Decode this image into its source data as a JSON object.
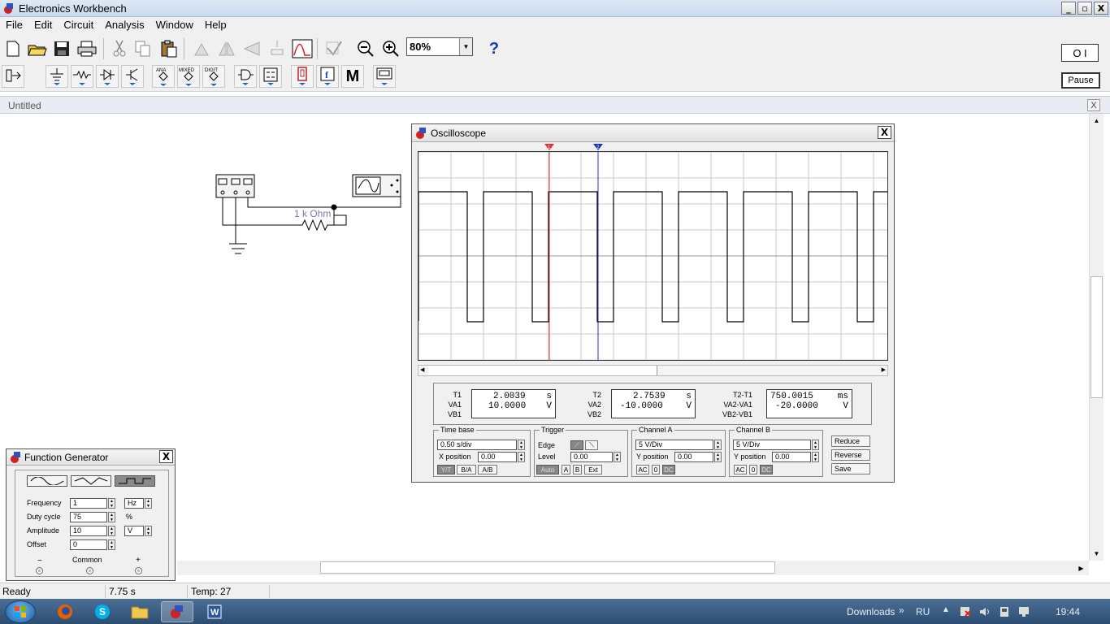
{
  "app": {
    "title": "Electronics Workbench",
    "min_glyph": "_",
    "restore_glyph": "▫",
    "close_glyph": "X"
  },
  "menu": [
    "File",
    "Edit",
    "Circuit",
    "Analysis",
    "Window",
    "Help"
  ],
  "toolbar": {
    "zoom_value": "80%",
    "help_label": "?",
    "power_label": "O I",
    "pause_label": "Pause",
    "parts_labels": {
      "analog": "ANA",
      "mixed": "MIXED",
      "digital": "DIGIT",
      "misc": "M"
    }
  },
  "document": {
    "title": "Untitled",
    "close_glyph": "X"
  },
  "circuit": {
    "resistor_label": "1 k Ohm"
  },
  "oscilloscope": {
    "title": "Oscilloscope",
    "close_glyph": "X",
    "cursor1_label": "1",
    "cursor2_label": "2",
    "readouts": {
      "t1_label": "T1",
      "va1_label": "VA1",
      "vb1_label": "VB1",
      "t1_value": "2.0039",
      "t1_unit": "s",
      "va1_value": "10.0000",
      "va1_unit": "V",
      "t2_label": "T2",
      "va2_label": "VA2",
      "vb2_label": "VB2",
      "t2_value": "2.7539",
      "t2_unit": "s",
      "va2_value": "-10.0000",
      "va2_unit": "V",
      "dt_label": "T2-T1",
      "dva_label": "VA2-VA1",
      "dvb_label": "VB2-VB1",
      "dt_value": "750.0015",
      "dt_unit": "ms",
      "dva_value": "-20.0000",
      "dva_unit": "V"
    },
    "timebase": {
      "group_label": "Time base",
      "value": "0.50 s/div",
      "xpos_label": "X position",
      "xpos_value": "0.00",
      "modes": [
        "Y/T",
        "B/A",
        "A/B"
      ]
    },
    "trigger": {
      "group_label": "Trigger",
      "edge_label": "Edge",
      "level_label": "Level",
      "level_value": "0.00",
      "sources": [
        "Auto",
        "A",
        "B",
        "Ext"
      ]
    },
    "channel_a": {
      "group_label": "Channel A",
      "value": "5 V/Div",
      "ypos_label": "Y position",
      "ypos_value": "0.00",
      "coupling": [
        "AC",
        "0",
        "DC"
      ]
    },
    "channel_b": {
      "group_label": "Channel B",
      "value": "5 V/Div",
      "ypos_label": "Y position",
      "ypos_value": "0.00",
      "coupling": [
        "AC",
        "0",
        "DC"
      ]
    },
    "buttons": {
      "reduce": "Reduce",
      "reverse": "Reverse",
      "save": "Save"
    }
  },
  "function_generator": {
    "title": "Function Generator",
    "close_glyph": "X",
    "frequency_label": "Frequency",
    "frequency_value": "1",
    "frequency_unit": "Hz",
    "duty_label": "Duty cycle",
    "duty_value": "75",
    "duty_unit": "%",
    "amplitude_label": "Amplitude",
    "amplitude_value": "10",
    "amplitude_unit": "V",
    "offset_label": "Offset",
    "offset_value": "0",
    "minus_label": "−",
    "common_label": "Common",
    "plus_label": "+"
  },
  "status": {
    "state": "Ready",
    "time": "7.75 s",
    "temp": "Temp:  27"
  },
  "taskbar": {
    "downloads": "Downloads",
    "chevron": "»",
    "lang": "RU",
    "clock": "19:44"
  },
  "colors": {
    "cursor1": "#e03030",
    "cursor2": "#2030c0",
    "trace": "#000000",
    "grid": "#c8c8c8"
  }
}
